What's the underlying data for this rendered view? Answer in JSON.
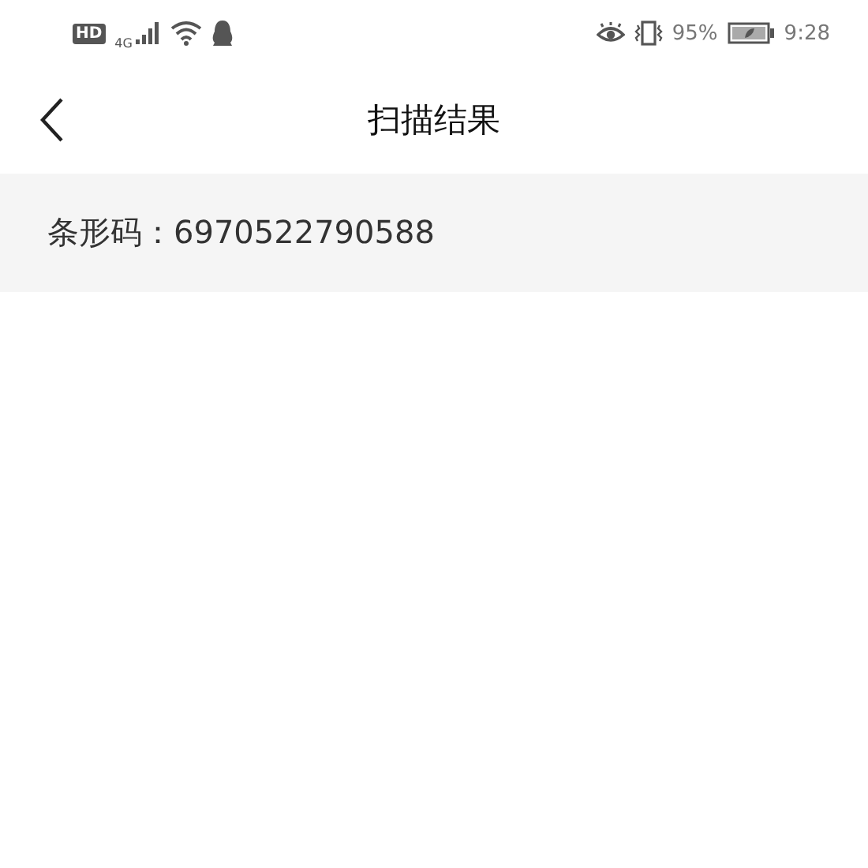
{
  "status_bar": {
    "hd_badge": "HD",
    "network": "4G",
    "battery": "95%",
    "time": "9:28"
  },
  "header": {
    "title": "扫描结果"
  },
  "result": {
    "text": "条形码：6970522790588"
  }
}
